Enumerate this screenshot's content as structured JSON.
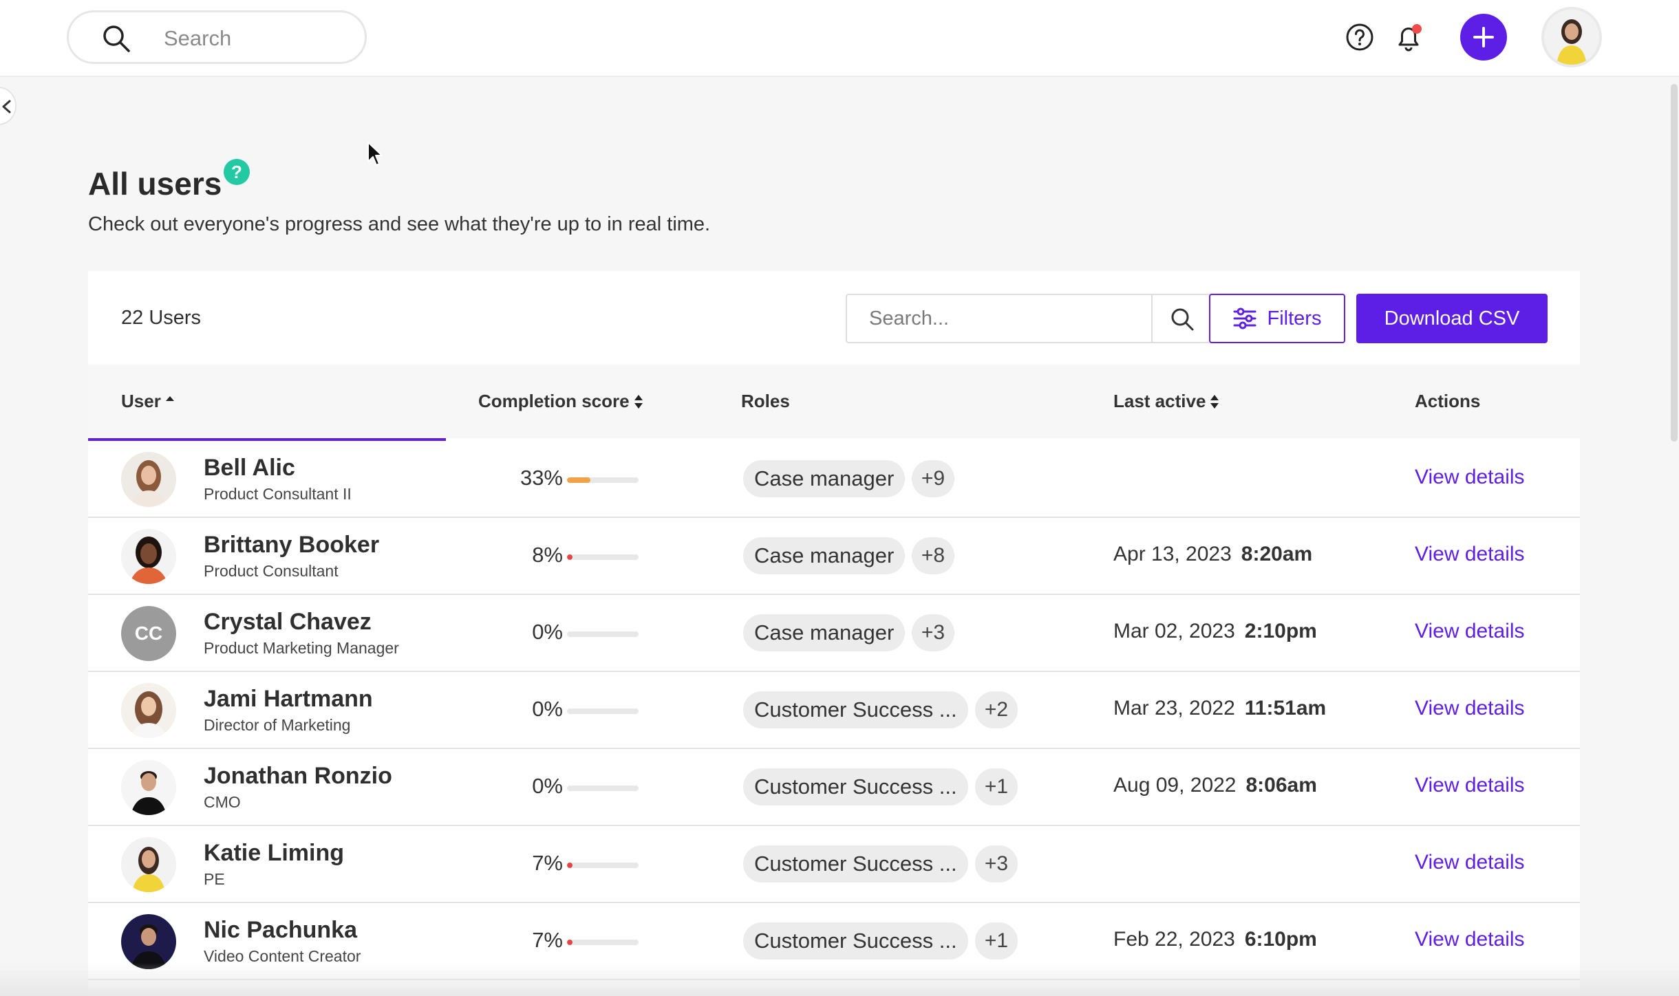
{
  "topbar": {
    "search_placeholder": "Search"
  },
  "header": {
    "title": "All users",
    "help_glyph": "?",
    "subtitle": "Check out everyone's progress and see what they're up to in real time."
  },
  "toolbar": {
    "user_count": "22 Users",
    "search_placeholder": "Search...",
    "filters_label": "Filters",
    "download_label": "Download CSV"
  },
  "table": {
    "columns": {
      "user": "User",
      "completion": "Completion score",
      "roles": "Roles",
      "last_active": "Last active",
      "actions": "Actions"
    },
    "rows": [
      {
        "name": "Bell Alic",
        "title": "Product Consultant II",
        "score": "33%",
        "progress": 0.33,
        "bar_color": "#f0a24a",
        "role": "Case manager",
        "more": "+9",
        "date": "",
        "time": "",
        "action": "View details",
        "avatar": "photo"
      },
      {
        "name": "Brittany Booker",
        "title": "Product Consultant",
        "score": "8%",
        "progress": 0.08,
        "bar_color": "#e04848",
        "role": "Case manager",
        "more": "+8",
        "date": "Apr 13, 2023",
        "time": "8:20am",
        "action": "View details",
        "avatar": "photo"
      },
      {
        "name": "Crystal Chavez",
        "title": "Product Marketing Manager",
        "score": "0%",
        "progress": 0,
        "bar_color": "#e04848",
        "role": "Case manager",
        "more": "+3",
        "date": "Mar 02, 2023",
        "time": "2:10pm",
        "action": "View details",
        "avatar": "initials",
        "initials": "CC"
      },
      {
        "name": "Jami Hartmann",
        "title": "Director of Marketing",
        "score": "0%",
        "progress": 0,
        "bar_color": "#e04848",
        "role": "Customer Success ...",
        "more": "+2",
        "date": "Mar 23, 2022",
        "time": "11:51am",
        "action": "View details",
        "avatar": "photo"
      },
      {
        "name": "Jonathan Ronzio",
        "title": "CMO",
        "score": "0%",
        "progress": 0,
        "bar_color": "#e04848",
        "role": "Customer Success ...",
        "more": "+1",
        "date": "Aug 09, 2022",
        "time": "8:06am",
        "action": "View details",
        "avatar": "photo"
      },
      {
        "name": "Katie Liming",
        "title": "PE",
        "score": "7%",
        "progress": 0.07,
        "bar_color": "#e04848",
        "role": "Customer Success ...",
        "more": "+3",
        "date": "",
        "time": "",
        "action": "View details",
        "avatar": "photo"
      },
      {
        "name": "Nic Pachunka",
        "title": "Video Content Creator",
        "score": "7%",
        "progress": 0.07,
        "bar_color": "#e04848",
        "role": "Customer Success ...",
        "more": "+1",
        "date": "Feb 22, 2023",
        "time": "6:10pm",
        "action": "View details",
        "avatar": "photo"
      }
    ]
  },
  "icons": {
    "search": "search-icon",
    "help": "help-circle-icon",
    "bell": "bell-icon",
    "plus": "plus-icon",
    "filters": "sliders-icon",
    "sort": "sort-icon"
  },
  "colors": {
    "accent": "#5d1fe6",
    "help_badge": "#22c9a3",
    "notification_dot": "#ef4b4b"
  }
}
